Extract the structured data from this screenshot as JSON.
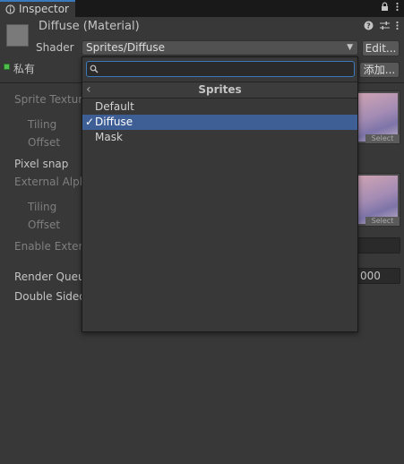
{
  "tab": {
    "label": "Inspector"
  },
  "header": {
    "title": "Diffuse (Material)",
    "shader_label": "Shader",
    "shader_value": "Sprites/Diffuse",
    "edit_label": "Edit...",
    "private_label": "私有",
    "add_label": "添加..."
  },
  "properties": {
    "sprite_texture": "Sprite Texture",
    "tiling1": "Tiling",
    "offset1": "Offset",
    "pixel_snap": "Pixel snap",
    "external_alpha": "External Alpha",
    "tiling2": "Tiling",
    "offset2": "Offset",
    "enable_external": "Enable Externa",
    "render_queue": "Render Queue",
    "render_queue_value": "000",
    "double_sided": "Double Sided",
    "select_label": "Select"
  },
  "popup": {
    "search_value": "",
    "search_placeholder": "",
    "breadcrumb": "Sprites",
    "options": [
      "Default",
      "Diffuse",
      "Mask"
    ],
    "selected_index": 1,
    "check_glyph": "✓"
  },
  "colors": {
    "background": "#383838",
    "accent": "#3a79bb",
    "selection": "#3e5f96"
  }
}
